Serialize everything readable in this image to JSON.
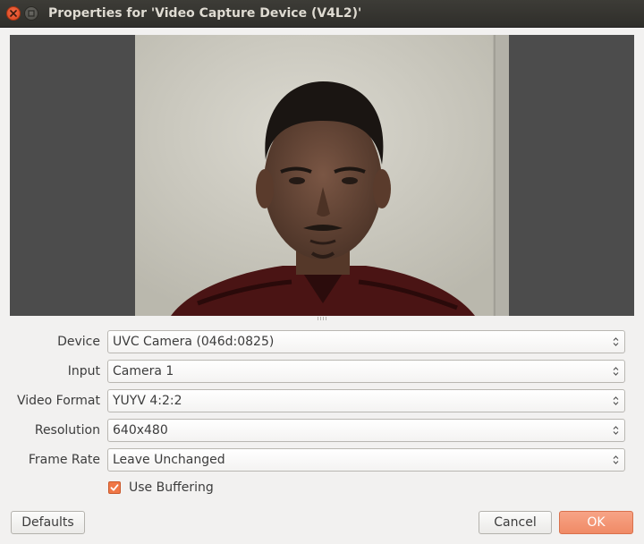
{
  "window": {
    "title": "Properties for 'Video Capture Device (V4L2)'"
  },
  "preview": {
    "description": "webcam-preview"
  },
  "form": {
    "fields": [
      {
        "label": "Device",
        "value": "UVC Camera (046d:0825)"
      },
      {
        "label": "Input",
        "value": "Camera 1"
      },
      {
        "label": "Video Format",
        "value": "YUYV 4:2:2"
      },
      {
        "label": "Resolution",
        "value": "640x480"
      },
      {
        "label": "Frame Rate",
        "value": "Leave Unchanged"
      }
    ],
    "use_buffering": {
      "label": "Use Buffering",
      "checked": true
    }
  },
  "buttons": {
    "defaults": "Defaults",
    "cancel": "Cancel",
    "ok": "OK"
  },
  "colors": {
    "accent": "#f08a66",
    "titlebar": "#3d3c37",
    "checkbox": "#f07746"
  }
}
